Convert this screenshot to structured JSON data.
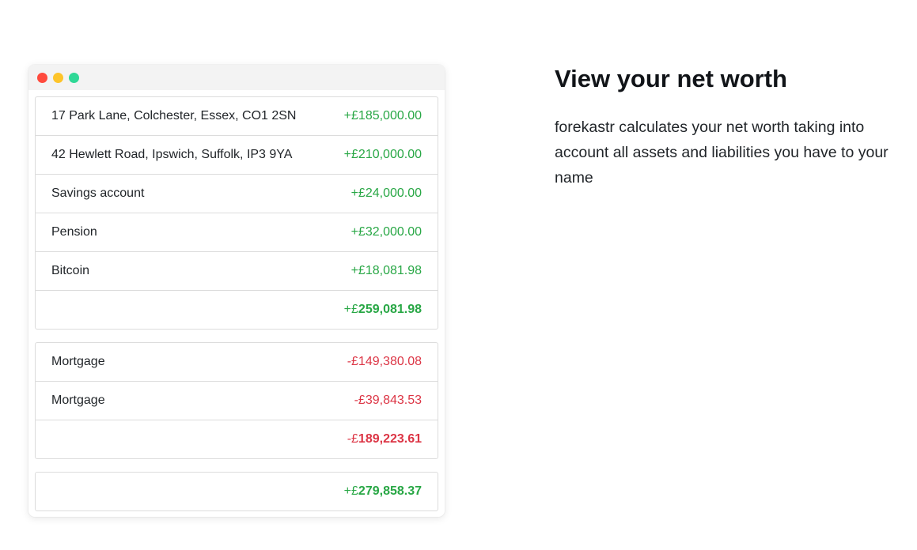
{
  "window": {
    "dots": [
      {
        "name": "close",
        "color": "#ff4a3d"
      },
      {
        "name": "minimize",
        "color": "#fdc42a"
      },
      {
        "name": "maximize",
        "color": "#2fd896"
      }
    ]
  },
  "assets": {
    "items": [
      {
        "label": "17 Park Lane, Colchester, Essex, CO1 2SN",
        "value": "+£185,000.00"
      },
      {
        "label": "42 Hewlett Road, Ipswich, Suffolk, IP3 9YA",
        "value": "+£210,000.00"
      },
      {
        "label": "Savings account",
        "value": "+£24,000.00"
      },
      {
        "label": "Pension",
        "value": "+£32,000.00"
      },
      {
        "label": "Bitcoin",
        "value": "+£18,081.98"
      }
    ],
    "total_sign": "+£",
    "total_amount": "259,081.98"
  },
  "liabilities": {
    "items": [
      {
        "label": "Mortgage",
        "value": "-£149,380.08"
      },
      {
        "label": "Mortgage",
        "value": "-£39,843.53"
      }
    ],
    "total_sign": "-£",
    "total_amount": "189,223.61"
  },
  "net_worth": {
    "sign": "+£",
    "amount": "279,858.37"
  },
  "info": {
    "heading": "View your net worth",
    "description": "forekastr calculates your net worth taking into account all assets and liabilities you have to your name"
  },
  "colors": {
    "positive": "#28a745",
    "negative": "#dc3545"
  }
}
